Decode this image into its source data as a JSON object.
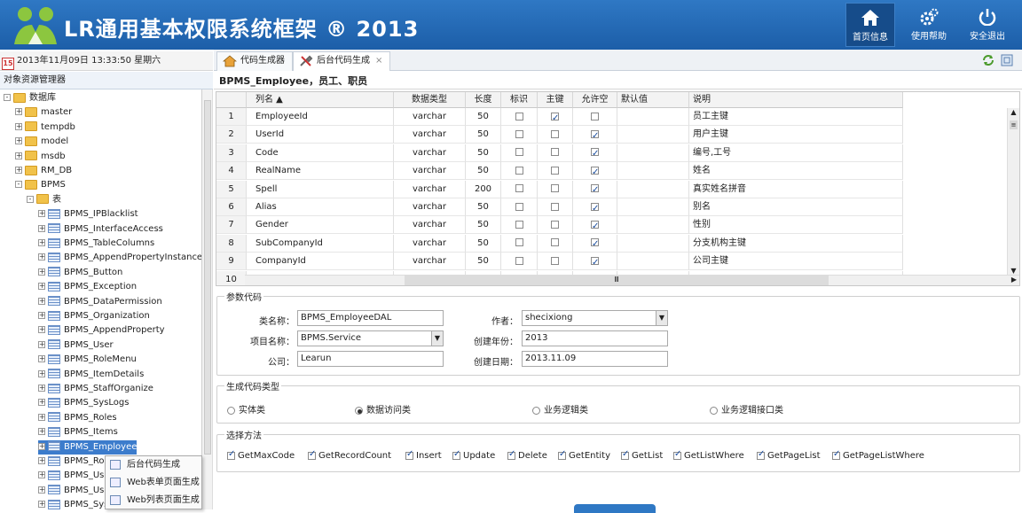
{
  "header": {
    "title": "LR通用基本权限系统框架 ® 2013",
    "buttons": [
      {
        "label": "首页信息",
        "icon": "home-icon"
      },
      {
        "label": "使用帮助",
        "icon": "gear-icon"
      },
      {
        "label": "安全退出",
        "icon": "power-icon"
      }
    ]
  },
  "datebar": {
    "day": "15",
    "text": "2013年11月09日 13:33:50 星期六"
  },
  "explorer": {
    "title": "对象资源管理器"
  },
  "tree": [
    {
      "label": "数据库",
      "level": 0,
      "type": "folder",
      "exp": "-"
    },
    {
      "label": "master",
      "level": 1,
      "type": "folder",
      "exp": "+"
    },
    {
      "label": "tempdb",
      "level": 1,
      "type": "folder",
      "exp": "+"
    },
    {
      "label": "model",
      "level": 1,
      "type": "folder",
      "exp": "+"
    },
    {
      "label": "msdb",
      "level": 1,
      "type": "folder",
      "exp": "+"
    },
    {
      "label": "RM_DB",
      "level": 1,
      "type": "folder",
      "exp": "+"
    },
    {
      "label": "BPMS",
      "level": 1,
      "type": "folder",
      "exp": "-"
    },
    {
      "label": "表",
      "level": 2,
      "type": "folder",
      "exp": "-"
    },
    {
      "label": "BPMS_IPBlacklist",
      "level": 3,
      "type": "table",
      "exp": "+"
    },
    {
      "label": "BPMS_InterfaceAccess",
      "level": 3,
      "type": "table",
      "exp": "+"
    },
    {
      "label": "BPMS_TableColumns",
      "level": 3,
      "type": "table",
      "exp": "+"
    },
    {
      "label": "BPMS_AppendPropertyInstance",
      "level": 3,
      "type": "table",
      "exp": "+"
    },
    {
      "label": "BPMS_Button",
      "level": 3,
      "type": "table",
      "exp": "+"
    },
    {
      "label": "BPMS_Exception",
      "level": 3,
      "type": "table",
      "exp": "+"
    },
    {
      "label": "BPMS_DataPermission",
      "level": 3,
      "type": "table",
      "exp": "+"
    },
    {
      "label": "BPMS_Organization",
      "level": 3,
      "type": "table",
      "exp": "+"
    },
    {
      "label": "BPMS_AppendProperty",
      "level": 3,
      "type": "table",
      "exp": "+"
    },
    {
      "label": "BPMS_User",
      "level": 3,
      "type": "table",
      "exp": "+"
    },
    {
      "label": "BPMS_RoleMenu",
      "level": 3,
      "type": "table",
      "exp": "+"
    },
    {
      "label": "BPMS_ItemDetails",
      "level": 3,
      "type": "table",
      "exp": "+"
    },
    {
      "label": "BPMS_StaffOrganize",
      "level": 3,
      "type": "table",
      "exp": "+"
    },
    {
      "label": "BPMS_SysLogs",
      "level": 3,
      "type": "table",
      "exp": "+"
    },
    {
      "label": "BPMS_Roles",
      "level": 3,
      "type": "table",
      "exp": "+"
    },
    {
      "label": "BPMS_Items",
      "level": 3,
      "type": "table",
      "exp": "+"
    },
    {
      "label": "BPMS_Employee",
      "level": 3,
      "type": "table",
      "exp": "+",
      "selected": true
    },
    {
      "label": "BPMS_Role",
      "level": 3,
      "type": "table",
      "exp": "+"
    },
    {
      "label": "BPMS_Use",
      "level": 3,
      "type": "table",
      "exp": "+"
    },
    {
      "label": "BPMS_Use",
      "level": 3,
      "type": "table",
      "exp": "+"
    },
    {
      "label": "BPMS_Sys",
      "level": 3,
      "type": "table",
      "exp": "+"
    }
  ],
  "context_menu": [
    "后台代码生成",
    "Web表单页面生成",
    "Web列表页面生成"
  ],
  "tabs": [
    {
      "label": "代码生成器",
      "active": false
    },
    {
      "label": "后台代码生成",
      "active": true,
      "closable": true
    }
  ],
  "table_title": "BPMS_Employee，员工、职员",
  "grid": {
    "headers": [
      "列名 ▲",
      "数据类型",
      "长度",
      "标识",
      "主键",
      "允许空",
      "默认值",
      "说明"
    ],
    "rows": [
      {
        "no": "1",
        "name": "EmployeeId",
        "type": "varchar",
        "len": "50",
        "identity": false,
        "pk": true,
        "nullable": false,
        "default": "",
        "desc": "员工主键"
      },
      {
        "no": "2",
        "name": "UserId",
        "type": "varchar",
        "len": "50",
        "identity": false,
        "pk": false,
        "nullable": true,
        "default": "",
        "desc": "用户主键"
      },
      {
        "no": "3",
        "name": "Code",
        "type": "varchar",
        "len": "50",
        "identity": false,
        "pk": false,
        "nullable": true,
        "default": "",
        "desc": "编号,工号"
      },
      {
        "no": "4",
        "name": "RealName",
        "type": "varchar",
        "len": "50",
        "identity": false,
        "pk": false,
        "nullable": true,
        "default": "",
        "desc": "姓名"
      },
      {
        "no": "5",
        "name": "Spell",
        "type": "varchar",
        "len": "200",
        "identity": false,
        "pk": false,
        "nullable": true,
        "default": "",
        "desc": "真实姓名拼音"
      },
      {
        "no": "6",
        "name": "Alias",
        "type": "varchar",
        "len": "50",
        "identity": false,
        "pk": false,
        "nullable": true,
        "default": "",
        "desc": "别名"
      },
      {
        "no": "7",
        "name": "Gender",
        "type": "varchar",
        "len": "50",
        "identity": false,
        "pk": false,
        "nullable": true,
        "default": "",
        "desc": "性别"
      },
      {
        "no": "8",
        "name": "SubCompanyId",
        "type": "varchar",
        "len": "50",
        "identity": false,
        "pk": false,
        "nullable": true,
        "default": "",
        "desc": "分支机构主键"
      },
      {
        "no": "9",
        "name": "CompanyId",
        "type": "varchar",
        "len": "50",
        "identity": false,
        "pk": false,
        "nullable": true,
        "default": "",
        "desc": "公司主键"
      },
      {
        "no": "10",
        "name": "",
        "type": "",
        "len": "",
        "identity": null,
        "pk": null,
        "nullable": null,
        "default": "",
        "desc": ""
      }
    ]
  },
  "params": {
    "legend": "参数代码",
    "class_label": "类名称：",
    "class_value": "BPMS_EmployeeDAL",
    "author_label": "作者：",
    "author_value": "shecixiong",
    "project_label": "项目名称：",
    "project_value": "BPMS.Service",
    "year_label": "创建年份：",
    "year_value": "2013",
    "company_label": "公司：",
    "company_value": "Learun",
    "date_label": "创建日期：",
    "date_value": "2013.11.09"
  },
  "codetype": {
    "legend": "生成代码类型",
    "options": [
      {
        "label": "实体类",
        "checked": false
      },
      {
        "label": "数据访问类",
        "checked": true
      },
      {
        "label": "业务逻辑类",
        "checked": false
      },
      {
        "label": "业务逻辑接口类",
        "checked": false
      }
    ]
  },
  "methods": {
    "legend": "选择方法",
    "items": [
      "GetMaxCode",
      "GetRecordCount",
      "Insert",
      "Update",
      "Delete",
      "GetEntity",
      "GetList",
      "GetListWhere",
      "GetPageList",
      "GetPageListWhere"
    ]
  },
  "colors": {
    "header": "#2f78c4",
    "selected": "#3c7ccc"
  }
}
